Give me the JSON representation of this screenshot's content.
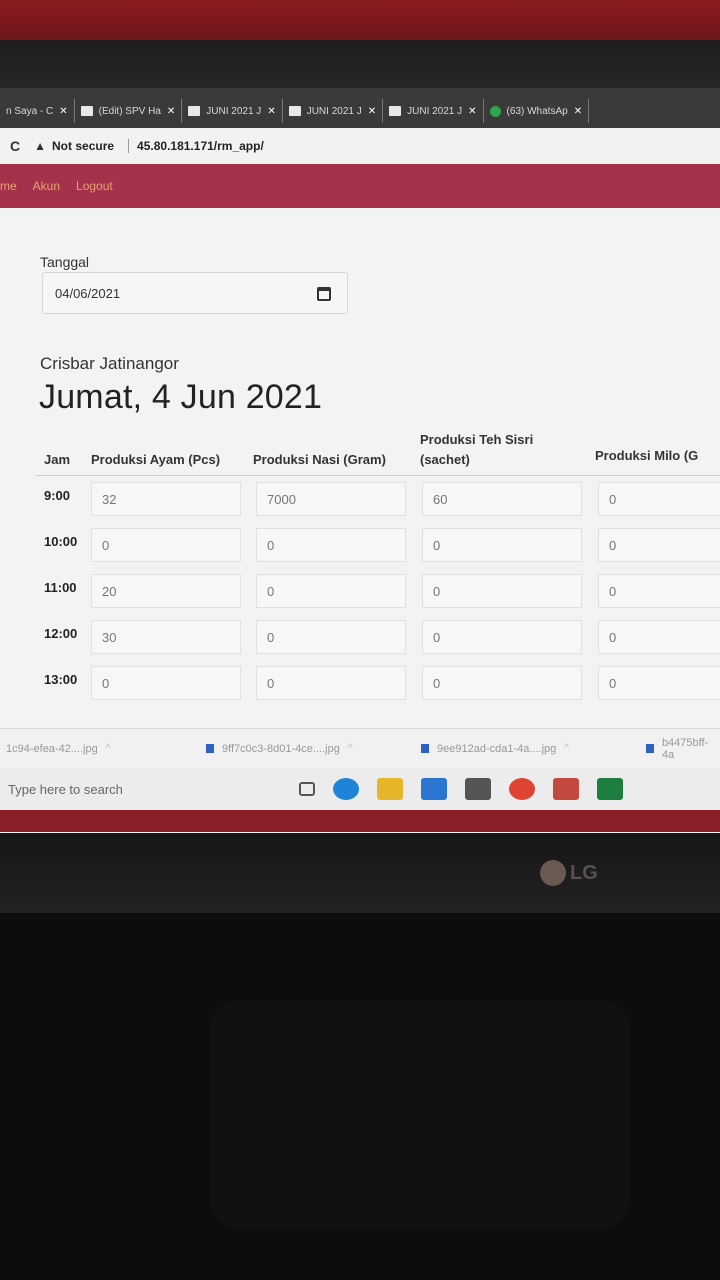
{
  "browser": {
    "tabs": [
      {
        "label": "n Saya - C",
        "icon": "page-icon"
      },
      {
        "label": "(Edit) SPV Ha",
        "icon": "sheet-icon"
      },
      {
        "label": "JUNI 2021 J",
        "icon": "sheet-icon"
      },
      {
        "label": "JUNI 2021 J",
        "icon": "sheet-icon"
      },
      {
        "label": "JUNI 2021 J",
        "icon": "sheet-icon"
      },
      {
        "label": "(63) WhatsAp",
        "icon": "whatsapp-icon"
      }
    ],
    "security_label": "Not secure",
    "url": "45.80.181.171/rm_app/"
  },
  "navbar": {
    "items": [
      "me",
      "Akun",
      "Logout"
    ]
  },
  "form": {
    "date_label": "Tanggal",
    "date_value": "04/06/2021"
  },
  "header": {
    "store_name": "Crisbar Jatinangor",
    "day_title": "Jumat, 4 Jun 2021"
  },
  "table": {
    "columns": [
      "Jam",
      "Produksi Ayam (Pcs)",
      "Produksi Nasi (Gram)",
      "Produksi Teh Sisri",
      "(sachet)",
      "Produksi Milo (G"
    ],
    "rows": [
      {
        "time": "9:00",
        "ayam": "32",
        "nasi": "7000",
        "teh": "60",
        "milo": "0"
      },
      {
        "time": "10:00",
        "ayam": "0",
        "nasi": "0",
        "teh": "0",
        "milo": "0"
      },
      {
        "time": "11:00",
        "ayam": "20",
        "nasi": "0",
        "teh": "0",
        "milo": "0"
      },
      {
        "time": "12:00",
        "ayam": "30",
        "nasi": "0",
        "teh": "0",
        "milo": "0"
      },
      {
        "time": "13:00",
        "ayam": "0",
        "nasi": "0",
        "teh": "0",
        "milo": "0"
      }
    ]
  },
  "downloads": [
    "1c94-efea-42....jpg",
    "9ff7c0c3-8d01-4ce....jpg",
    "9ee912ad-cda1-4a....jpg",
    "b4475bff-4a"
  ],
  "taskbar": {
    "search_placeholder": "Type here to search",
    "icons": [
      "task-view-icon",
      "edge-icon",
      "file-explorer-icon",
      "mail-icon",
      "store-icon",
      "chrome-icon",
      "chrome-alt-icon",
      "excel-icon"
    ]
  },
  "monitor": {
    "brand": "LG"
  },
  "colors": {
    "navbar": "#a5314a",
    "navbar_text": "#e4a46f"
  }
}
